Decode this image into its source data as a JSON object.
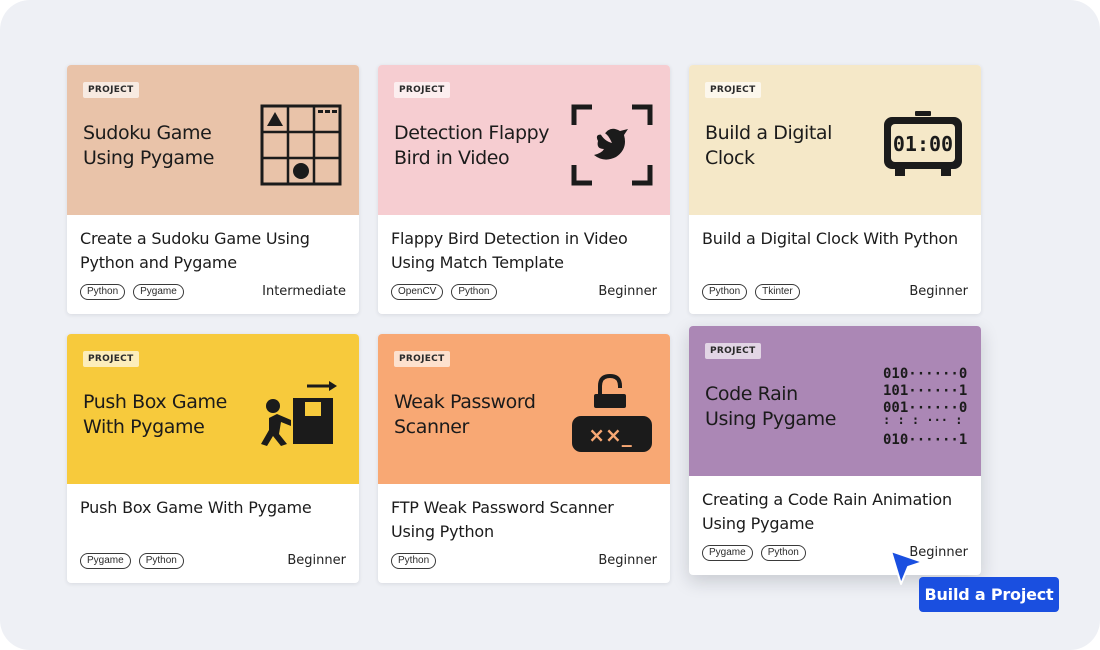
{
  "colors": {
    "frame_bg": "#eef0f5",
    "cta_bg": "#1a4fe0",
    "cursor": "#1a4fe0"
  },
  "cards": [
    {
      "badge": "PROJECT",
      "banner_title": "Sudoku Game\nUsing Pygame",
      "banner_color": "#e9c3a9",
      "icon": "sudoku-grid-icon",
      "title": "Create a Sudoku Game Using Python and Pygame",
      "tags": [
        "Python",
        "Pygame"
      ],
      "level": "Intermediate"
    },
    {
      "badge": "PROJECT",
      "banner_title": "Detection Flappy\nBird  in Video",
      "banner_color": "#f6cdd1",
      "icon": "bird-frame-icon",
      "title": "Flappy Bird Detection in Video Using Match Template",
      "tags": [
        "OpenCV",
        "Python"
      ],
      "level": "Beginner"
    },
    {
      "badge": "PROJECT",
      "banner_title": "Build a Digital\nClock",
      "banner_color": "#f5e8c8",
      "icon": "digital-clock-icon",
      "title": "Build a Digital Clock With Python",
      "tags": [
        "Python",
        "Tkinter"
      ],
      "level": "Beginner",
      "icon_text": "01:00"
    },
    {
      "badge": "PROJECT",
      "banner_title": "Push Box Game\nWith Pygame",
      "banner_color": "#f7ca3c",
      "icon": "push-box-icon",
      "title": "Push Box Game With Pygame",
      "tags": [
        "Pygame",
        "Python"
      ],
      "level": "Beginner"
    },
    {
      "badge": "PROJECT",
      "banner_title": "Weak Password\nScanner",
      "banner_color": "#f8a874",
      "icon": "unlock-keyboard-icon",
      "title": "FTP Weak Password Scanner Using Python",
      "tags": [
        "Python"
      ],
      "level": "Beginner",
      "icon_text": "××_"
    },
    {
      "badge": "PROJECT",
      "banner_title": "Code Rain\nUsing Pygame",
      "banner_color": "#ab87b5",
      "icon": "binary-code-icon",
      "title": "Creating a Code Rain Animation Using Pygame",
      "tags": [
        "Pygame",
        "Python"
      ],
      "level": "Beginner",
      "icon_lines": [
        "010······0",
        "101······1",
        "001······0",
        ": :  :  ···  :",
        "010······1"
      ]
    }
  ],
  "cursor_icon": "pointer-arrow-icon",
  "cta_label": "Build a Project"
}
